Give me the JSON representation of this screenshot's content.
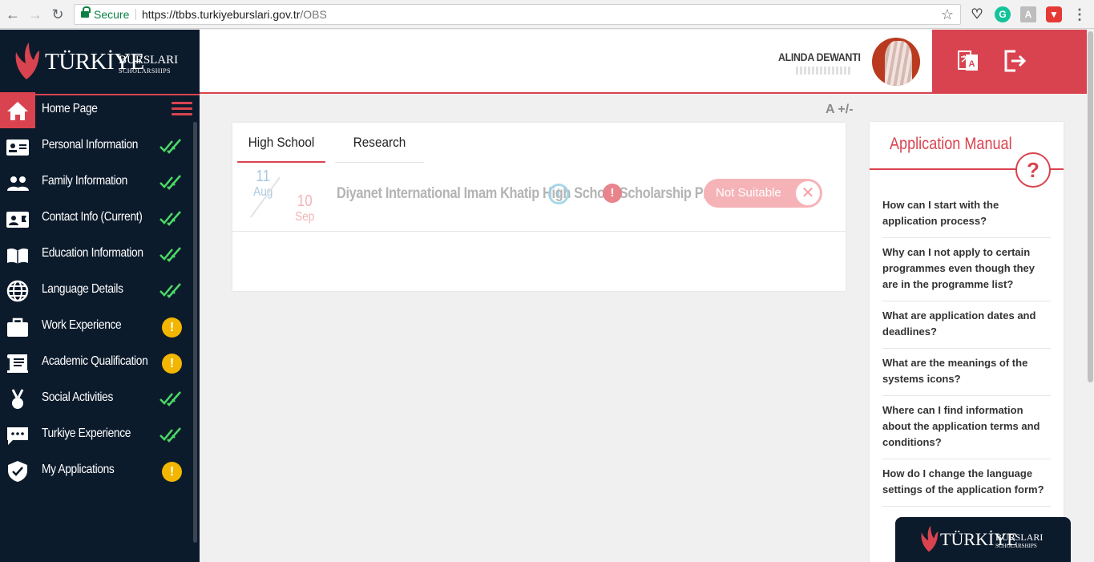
{
  "browser": {
    "secure_label": "Secure",
    "url_host": "https://tbbs.turkiyeburslari.gov.tr",
    "url_path": "/OBS"
  },
  "brand": {
    "word1": "TÜRKİYE",
    "word2": "BURSLARI",
    "word3": "SCHOLARSHIPS"
  },
  "sidebar": {
    "items": [
      {
        "label": "Home Page",
        "status": "none"
      },
      {
        "label": "Personal Information",
        "status": "done"
      },
      {
        "label": "Family Information",
        "status": "done"
      },
      {
        "label": "Contact Info (Current)",
        "status": "done"
      },
      {
        "label": "Education Information",
        "status": "done"
      },
      {
        "label": "Language Details",
        "status": "done"
      },
      {
        "label": "Work Experience",
        "status": "warning"
      },
      {
        "label": "Academic Qualification",
        "status": "warning"
      },
      {
        "label": "Social Activities",
        "status": "done"
      },
      {
        "label": "Turkiye Experience",
        "status": "done"
      },
      {
        "label": "My Applications",
        "status": "warning"
      }
    ],
    "warn_glyph": "!"
  },
  "header": {
    "username": "ALINDA DEWANTI"
  },
  "font_control": "A +/-",
  "tabs": [
    "High School",
    "Research"
  ],
  "application": {
    "start_day": "11",
    "start_month": "Aug",
    "end_day": "10",
    "end_month": "Sep",
    "program": "Diyanet International Imam Khatip High School Scholarship Program",
    "info_glyph": "i",
    "warn_glyph": "!",
    "status": "Not Suitable",
    "close_glyph": "✕"
  },
  "manual": {
    "title": "Application Manual",
    "help_glyph": "?",
    "questions": [
      "How can I start with the application process?",
      "Why can I not apply to certain programmes even though they are in the programme list?",
      "What are application dates and deadlines?",
      "What are the meanings of the systems icons?",
      "Where can I find information about the application terms and conditions?",
      "How do I change the language settings of the application form?"
    ]
  },
  "colors": {
    "accent": "#d9434f",
    "sidebar_bg": "#0c1b2c",
    "check": "#4cd964",
    "warning": "#f2b600"
  }
}
